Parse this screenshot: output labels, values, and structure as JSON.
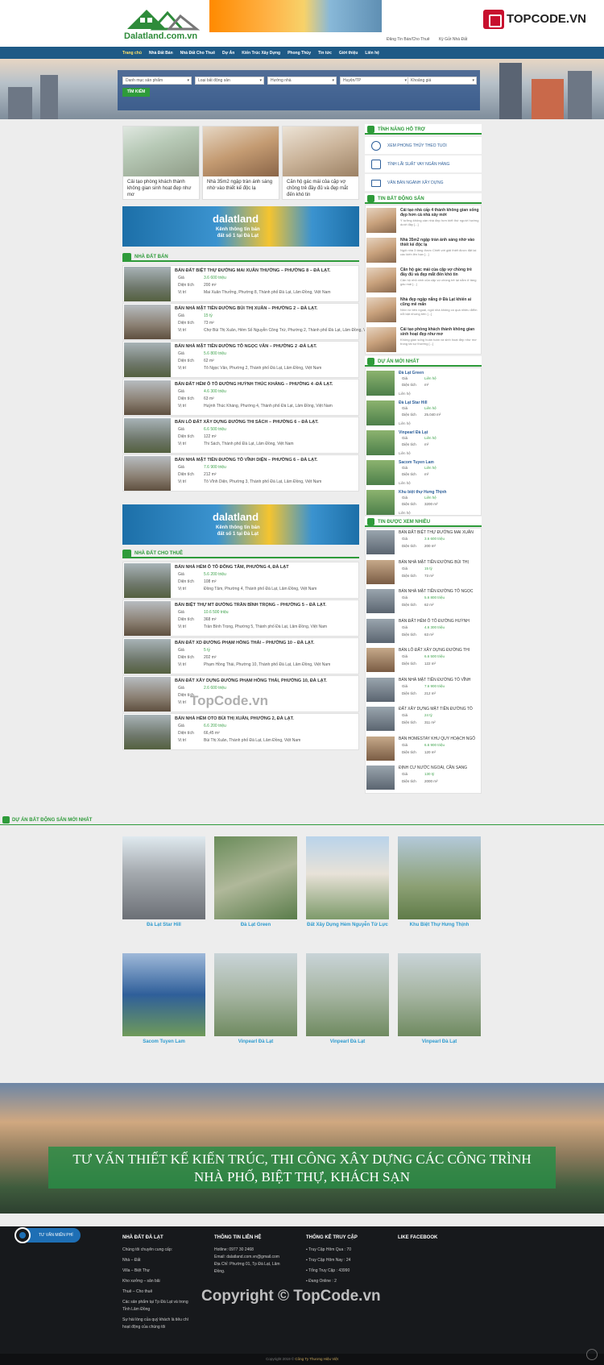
{
  "header": {
    "logo_text": "Dalatland.com.vn",
    "links": [
      "Đăng Tin Bán/Cho Thuê",
      "Ký Gửi Nhà Đất"
    ],
    "brand": "TOPCODE.VN"
  },
  "nav": [
    "Trang chủ",
    "Nhà Đất Bán",
    "Nhà Đất Cho Thuê",
    "Dự Án",
    "Kiến Trúc Xây Dựng",
    "Phong Thủy",
    "Tin tức",
    "Giới thiệu",
    "Liên hệ"
  ],
  "search": {
    "selects": [
      "Danh mục sản phẩm",
      "Loại bất động sản",
      "Hướng nhà",
      "Huyện/TP",
      "Khoảng giá"
    ],
    "button": "TÌM KIẾM"
  },
  "features": [
    {
      "caption": "Cải tạo phòng khách thành không gian sinh hoạt đẹp như mơ"
    },
    {
      "caption": "Nhà 35m2 ngập tràn ánh sáng nhờ vào thiết kế độc lạ"
    },
    {
      "caption": "Căn hộ gác mái của cặp vợ chồng trẻ đầy đủ và đẹp mắt đến khó tin"
    }
  ],
  "ad": {
    "title": "dalatland",
    "line1": "Kênh thông tin bán",
    "line2": "đất số 1 tại Đà Lạt"
  },
  "sections": {
    "ban": "NHÀ ĐẤT BÁN",
    "thue": "NHÀ ĐẤT CHO THUÊ",
    "tools": "TÍNH NĂNG HỖ TRỢ",
    "news": "TIN BẤT ĐỘNG SẢN",
    "projects": "DỰ ÁN MỚI NHẤT",
    "views": "TIN ĐƯỢC XEM NHIỀU",
    "projgrid": "DỰ ÁN BẤT ĐỘNG SẢN MỚI NHẤT"
  },
  "labels": {
    "price": "Giá",
    "area": "Diện tích",
    "loc": "Vị trí",
    "colon": ":"
  },
  "ban": [
    {
      "title": "BÁN ĐẤT BIỆT THỰ ĐƯỜNG MAI XUÂN THƯỞNG – PHƯỜNG 8 – ĐÀ LẠT.",
      "price": "3.6 600 triệu",
      "area": "200 m²",
      "loc": "Mai Xuân Thưởng, Phường 8, Thành phố Đà Lạt, Lâm Đồng, Việt Nam"
    },
    {
      "title": "BÁN NHÀ MẶT TIỀN ĐƯỜNG BÙI THỊ XUÂN – PHƯỜNG 2 – ĐÀ LẠT.",
      "price": "15 tỷ",
      "area": "73 m²",
      "loc": "Chợ Bùi Thị Xuân, Hẻm Số Nguyễn Công Trứ, Phường 2, Thành phố Đà Lạt, Lâm Đồng, Việt Nam"
    },
    {
      "title": "BÁN NHÀ MẶT TIỀN ĐƯỜNG TÔ NGỌC VÂN – PHƯỜNG 2 -ĐÀ LẠT.",
      "price": "5.6 800 triệu",
      "area": "62 m²",
      "loc": "Tô Ngọc Vân, Phường 2, Thành phố Đà Lạt, Lâm Đồng, Việt Nam"
    },
    {
      "title": "BÁN ĐẤT HẺM Ô TÔ ĐƯỜNG HUỲNH THÚC KHÁNG – PHƯỜNG 4 -ĐÀ LẠT.",
      "price": "4.6 300 triệu",
      "area": "63 m²",
      "loc": "Huỳnh Thúc Kháng, Phường 4, Thành phố Đà Lạt, Lâm Đồng, Việt Nam"
    },
    {
      "title": "BÁN LÔ ĐẤT XÂY DỰNG ĐƯỜNG THI SÁCH – PHƯỜNG 6 – ĐÀ LẠT.",
      "price": "6.6 500 triệu",
      "area": "122 m²",
      "loc": "Thi Sách, Thành phố Đà Lạt, Lâm Đồng, Việt Nam"
    },
    {
      "title": "BÁN NHÀ MẶT TIỀN ĐƯỜNG TÔ VĨNH DIỆN – PHƯỜNG 6 – ĐÀ LẠT.",
      "price": "7.6 900 triệu",
      "area": "212 m²",
      "loc": "Tô Vĩnh Diện, Phường 3, Thành phố Đà Lạt, Lâm Đồng, Việt Nam"
    }
  ],
  "thue": [
    {
      "title": "BÁN NHÀ HẺM Ô TÔ ĐÔNG TÂM, PHƯỜNG 4, ĐÀ LẠT",
      "price": "5.6 200 triệu",
      "area": "108 m²",
      "loc": "Đồng Tâm, Phường 4, Thành phố Đà Lạt, Lâm Đồng, Việt Nam"
    },
    {
      "title": "BÁN BIỆT THỰ MT ĐƯỜNG TRẦN BÌNH TRỌNG – PHƯỜNG 5 – ĐÀ LẠT.",
      "price": "10.6 500 triệu",
      "area": "368 m²",
      "loc": "Trần Bình Trọng, Phường 5, Thành phố Đà Lạt, Lâm Đồng, Việt Nam"
    },
    {
      "title": "BÁN ĐẤT XD ĐƯỜNG PHẠM HỒNG THÁI – PHƯỜNG 10 – ĐÀ LẠT.",
      "price": "5 tỷ",
      "area": "202 m²",
      "loc": "Phạm Hồng Thái, Phường 10, Thành phố Đà Lạt, Lâm Đồng, Việt Nam"
    },
    {
      "title": "BÁN ĐẤT XÂY DỰNG ĐƯỜNG PHẠM HỒNG THÁI, PHƯỜNG 10, ĐÀ LẠT.",
      "price": "2.6 600 triệu",
      "area": "",
      "loc": ""
    },
    {
      "title": "BÁN NHÀ HẺM OTO BÙI THỊ XUÂN, PHƯỜNG 2, ĐÀ LẠT.",
      "price": "6.6 200 triệu",
      "area": "66,45 m²",
      "loc": "Bùi Thị Xuân, Thành phố Đà Lạt, Lâm Đồng, Việt Nam"
    }
  ],
  "tools": [
    "XEM PHONG THỦY THEO TUỔI",
    "TÍNH LÃI SUẤT VAY NGÂN HÀNG",
    "VĂN BẢN NGÀNH XÂY DỰNG"
  ],
  "news": [
    {
      "title": "Cải tạo nhà cấp 4 thành không gian sống đẹp hơn cả nhà xây mới",
      "desc": "Ý tưởng không cần nhà đẹp hơn biết thứ người hướng dưới đây [...]"
    },
    {
      "title": "Nhà 35m2 ngập tràn ánh sáng nhờ vào thiết kế độc lạ",
      "desc": "Ngôi nhà 3 tầng được Chiết với giải thiết được đặt lại các kiến lên hạn [...]"
    },
    {
      "title": "Căn hộ gác mái của cặp vợ chồng trẻ đầy đủ và đẹp mắt đến khó tin",
      "desc": "Căn hộ nhỏ xinh của cặp vợ chồng trẻ lại nằm ở tầng gác mái [...]"
    },
    {
      "title": "Nhà đẹp ngập nắng ở Đà Lạt khiến ai cũng mê mẩn",
      "desc": "Nhìn từ bên ngoài, ngôi nhà không có quá nhiều điểm nổi bật nhưng bên [...]"
    },
    {
      "title": "Cải tạo phòng khách thành không gian sinh hoạt đẹp như mơ",
      "desc": "Không gian sống hoàn toàn và sinh hoạt đẹp như mơ trong tài sự thường [...]"
    }
  ],
  "projects": [
    {
      "name": "Đà Lạt Green",
      "price": "Liên hệ",
      "area": "m²",
      "loc": "Liên hệ"
    },
    {
      "name": "Đà Lạt Star Hill",
      "price": "Liên hệ",
      "area": "25.040 m²",
      "loc": "Liên hệ"
    },
    {
      "name": "Vinpearl Đà Lạt",
      "price": "Liên hệ",
      "area": "m²",
      "loc": "Liên hệ"
    },
    {
      "name": "Sacom Tuyen Lam",
      "price": "Liên hệ",
      "area": "m²",
      "loc": "Liên hệ"
    },
    {
      "name": "Khu biệt thự Hưng Thịnh",
      "price": "Liên hệ",
      "area": "3200 m²",
      "loc": "Liên hệ"
    }
  ],
  "views": [
    {
      "title": "BÁN ĐẤT BIỆT THỰ ĐƯỜNG MAI XUÂN",
      "price": "3.6 600 triệu",
      "area": "200 m²"
    },
    {
      "title": "BÁN NHÀ MẶT TIỀN ĐƯỜNG BÙI THỊ",
      "price": "15 tỷ",
      "area": "73 m²"
    },
    {
      "title": "BÁN NHÀ MẶT TIỀN ĐƯỜNG TÔ NGỌC",
      "price": "5.6 800 triệu",
      "area": "62 m²"
    },
    {
      "title": "BÁN ĐẤT HẺM Ô TÔ ĐƯỜNG HUỲNH",
      "price": "4.6 300 triệu",
      "area": "63 m²"
    },
    {
      "title": "BÁN LÔ ĐẤT XÂY DỰNG ĐƯỜNG THI",
      "price": "6.6 500 triệu",
      "area": "122 m²"
    },
    {
      "title": "BÁN NHÀ MẶT TIỀN ĐƯỜNG TÔ VĨNH",
      "price": "7.6 900 triệu",
      "area": "212 m²"
    },
    {
      "title": "ĐẤT XÂY DỰNG MẶT TIỀN ĐƯỜNG TÔ",
      "price": "24 tỷ",
      "area": "311 m²"
    },
    {
      "title": "BÁN HOMESTAY KHU QUY HOẠCH NGÔ",
      "price": "6.6 900 triệu",
      "area": "120 m²"
    },
    {
      "title": "ĐỊNH CƯ NƯỚC NGOÀI, CẦN SANG",
      "price": "130 tỷ",
      "area": "2000 m²"
    }
  ],
  "grid": [
    "Đà Lạt Star Hill",
    "Đà Lạt Green",
    "Đất Xây Dựng Hẻm Nguyễn Tử Lực",
    "Khu Biệt Thự Hưng Thịnh",
    "Sacom Tuyen Lam",
    "Vinpearl Đà Lạt",
    "Vinpearl Đà Lạt",
    "Vinpearl Đà Lạt"
  ],
  "cta": {
    "line1": "TƯ VẤN THIẾT KẾ KIẾN TRÚC, THI CÔNG XÂY DỰNG CÁC CÔNG TRÌNH",
    "line2": "NHÀ PHỐ, BIỆT THỰ, KHÁCH SẠN"
  },
  "footer": {
    "c1": {
      "h": "NHÀ ĐẤT ĐÀ LẠT",
      "items": [
        "Chúng tôi chuyên cung cấp:",
        "Nhà – Đất",
        "Villa – Biệt Thự",
        "Kho xưởng – sân bãi",
        "Thuê – Cho thuê",
        "Các sản phẩm tại Tp Đà Lạt và trong",
        "Tỉnh Lâm Đồng",
        "Sự hài lòng của quý khách là tiêu chí",
        "hoạt động của chúng tôi"
      ]
    },
    "c2": {
      "h": "THÔNG TIN LIÊN HỆ",
      "items": [
        "Hotline: 0977 30 2468",
        "Email: dalatland.com.vn@gmail.com",
        "Địa Chỉ: Phường 01, Tp Đà Lạt, Lâm",
        "Đồng."
      ]
    },
    "c3": {
      "h": "THỐNG KÊ TRUY CẬP",
      "items": [
        "Truy Cập Hôm Qua : 70",
        "Truy Cập Hôm Nay : 24",
        "Tổng Truy Cập : 43990",
        "Đang Online : 2"
      ]
    },
    "c4": {
      "h": "LIKE FACEBOOK"
    },
    "call": "TƯ VẤN MIỄN PHÍ",
    "copyright_pre": "Copyright 2019 ©",
    "copyright_b": "Công Ty Thương Hiệu Việt"
  },
  "watermarks": {
    "mid": "TopCode.vn",
    "foot": "Copyright © TopCode.vn"
  }
}
